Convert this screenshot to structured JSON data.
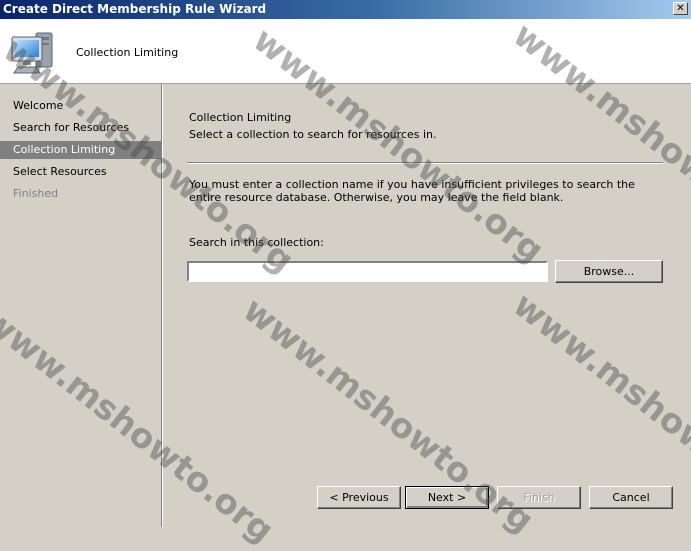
{
  "window": {
    "title": "Create Direct Membership Rule Wizard",
    "close_glyph": "✕"
  },
  "header": {
    "title": "Collection Limiting",
    "icon": "computer-icon"
  },
  "nav": {
    "items": [
      {
        "label": "Welcome",
        "state": "normal"
      },
      {
        "label": "Search for Resources",
        "state": "normal"
      },
      {
        "label": "Collection Limiting",
        "state": "active"
      },
      {
        "label": "Select Resources",
        "state": "normal"
      },
      {
        "label": "Finished",
        "state": "disabled"
      }
    ]
  },
  "page": {
    "title": "Collection Limiting",
    "subtitle": "Select a collection to search for resources in.",
    "info": "You must enter a collection name if you have insufficient privileges to search the entire resource database. Otherwise, you may leave the field blank.",
    "field_label": "Search in this collection:",
    "field_value": "",
    "browse_label": "Browse..."
  },
  "footer": {
    "previous_label": "< Previous",
    "next_label": "Next >",
    "finish_label": "Finish",
    "cancel_label": "Cancel"
  },
  "watermark": {
    "text": "www.mshowto.org"
  },
  "colors": {
    "titlebar_start": "#0a246a",
    "titlebar_end": "#a6caf0",
    "dialog_face": "#d4d0c8",
    "nav_active": "#808080"
  }
}
